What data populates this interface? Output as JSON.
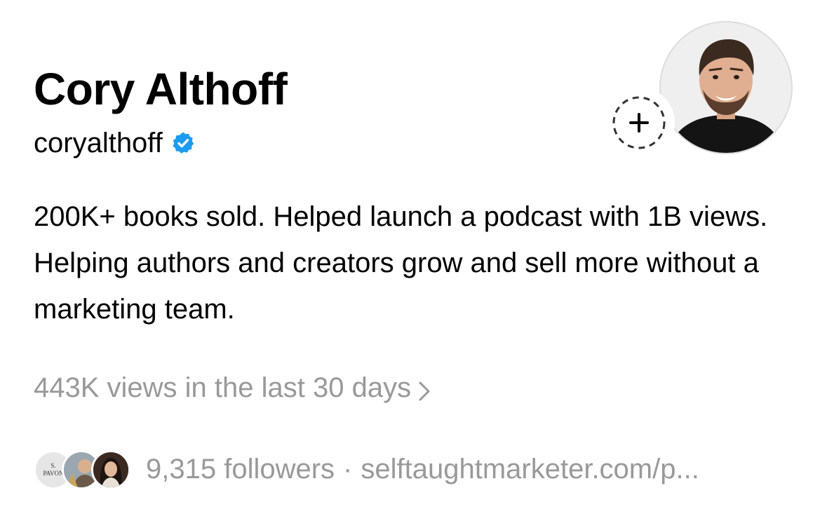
{
  "profile": {
    "name": "Cory Althoff",
    "username": "coryalthoff",
    "verified": true
  },
  "bio": "200K+ books sold. Helped launch a podcast with 1B views. Helping authors and creators grow and sell more without a marketing team.",
  "insights": {
    "views_text": "443K views in the last 30 days"
  },
  "followers": {
    "count_text": "9,315 followers",
    "separator": "·",
    "link_text": "selftaughtmarketer.com/p...",
    "avatar_1_label": "S. PAVON"
  },
  "colors": {
    "primary_text": "#000000",
    "secondary_text": "#999999",
    "verified_blue": "#1d9bf0"
  },
  "icons": {
    "verified": "verified-badge-icon",
    "add_story": "add-story-icon",
    "chevron": "chevron-right-icon"
  }
}
